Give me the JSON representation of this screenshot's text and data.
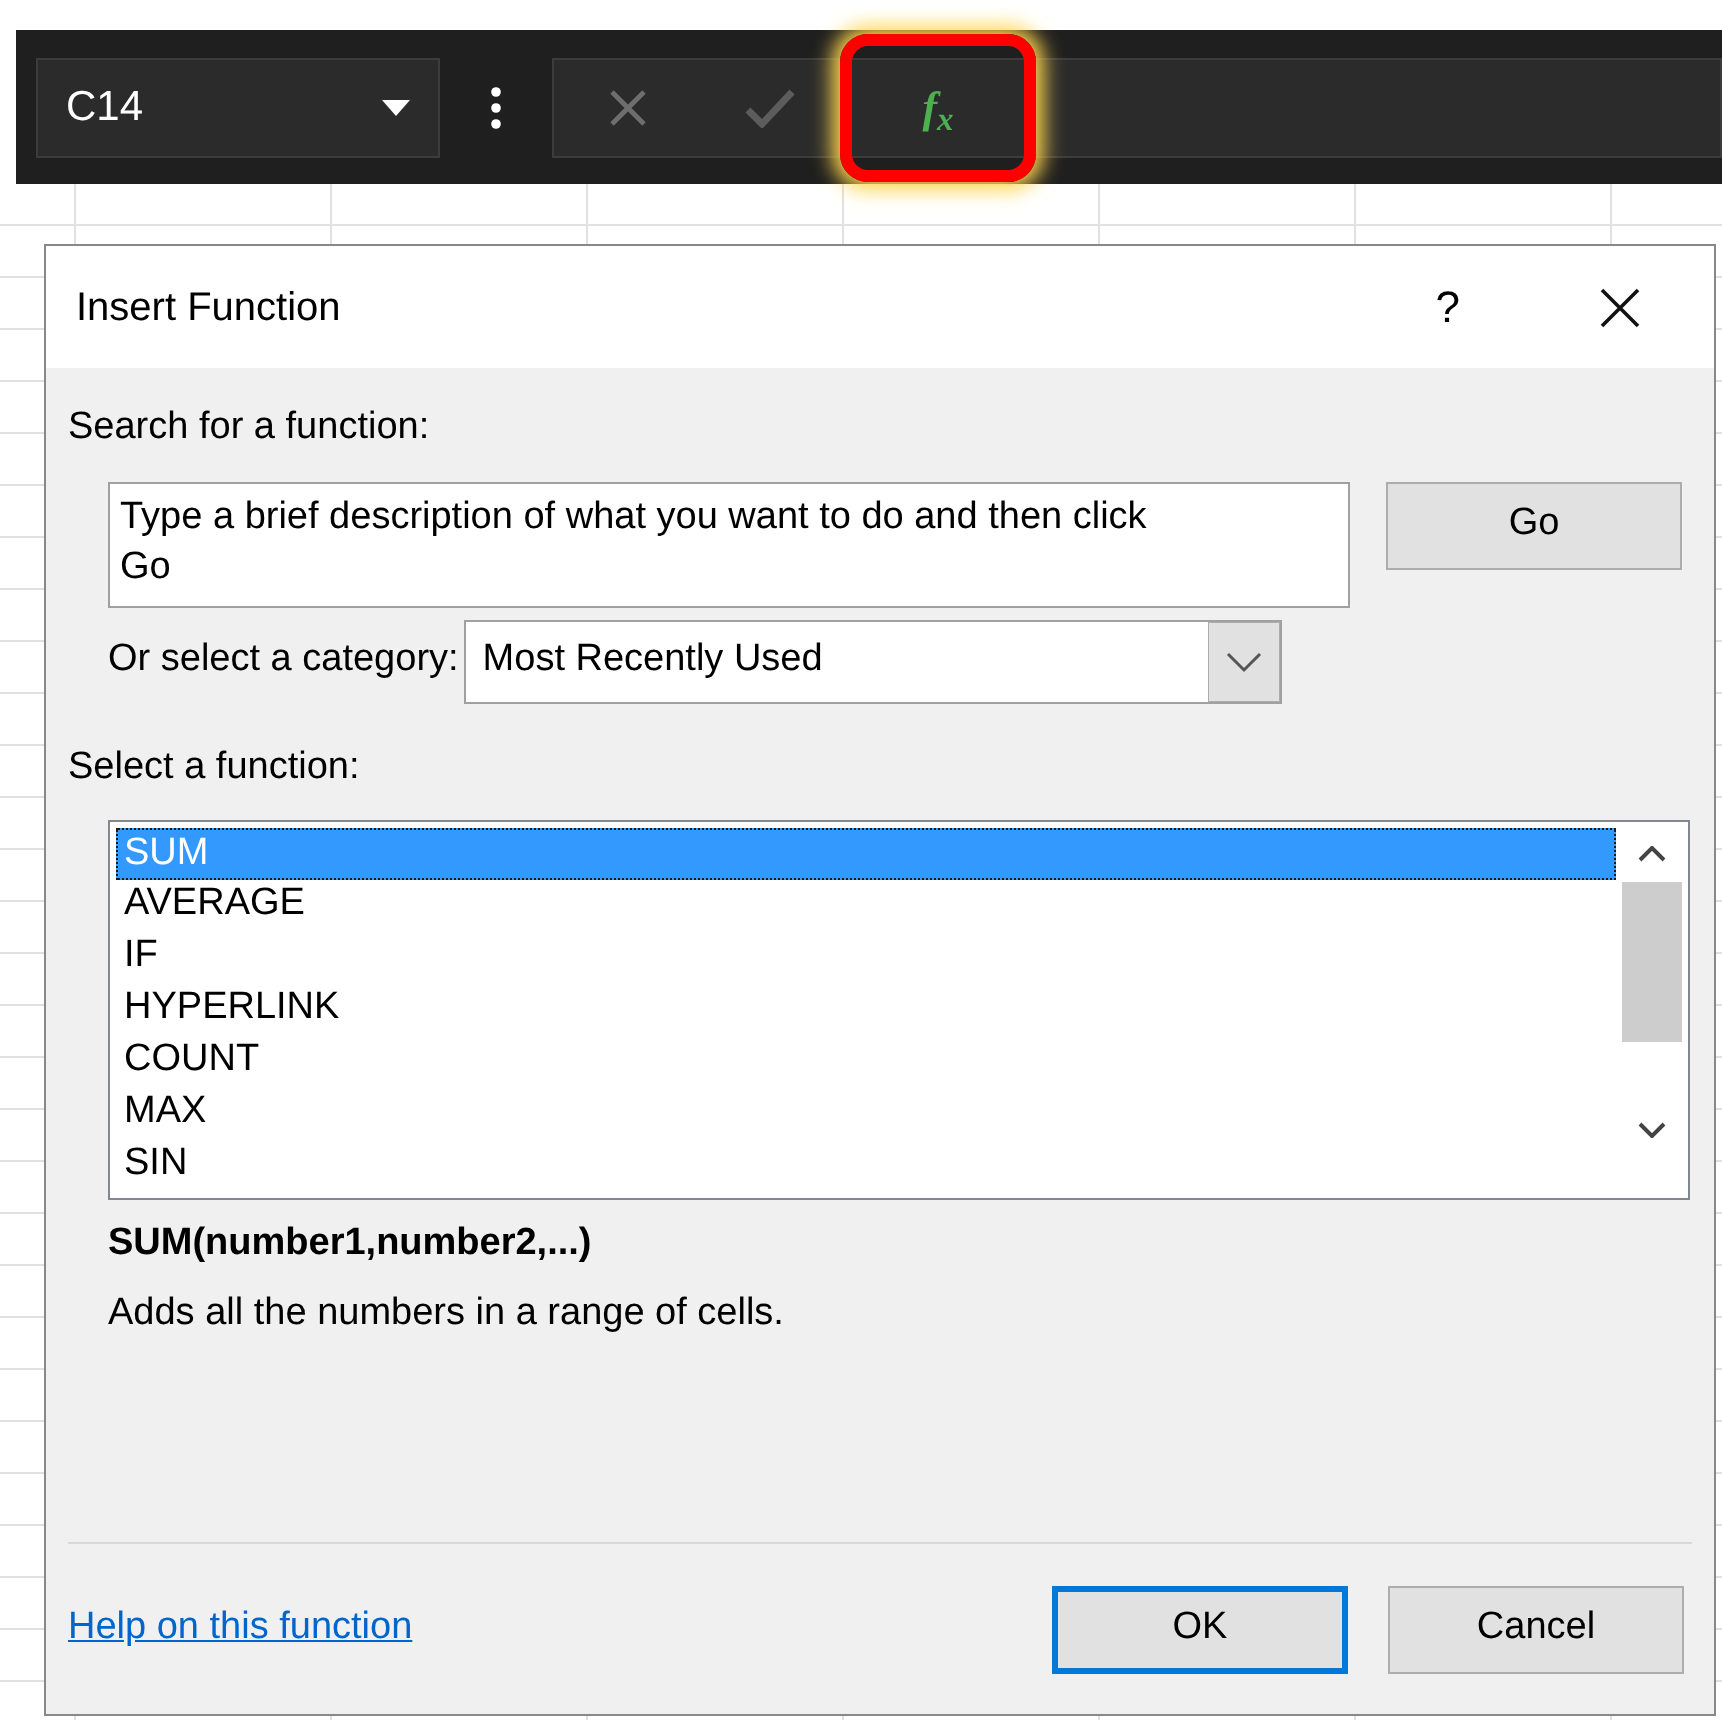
{
  "formula_bar": {
    "name_box": "C14",
    "fx_label": "f$_{x}$",
    "fx_highlighted": true
  },
  "dialog": {
    "title": "Insert Function",
    "help": "?",
    "search_label": "Search for a function:",
    "search_value": "Type a brief description of what you want to do and then click Go",
    "go_button": "Go",
    "category_label": "Or select a category:",
    "category_value": "Most Recently Used",
    "function_label": "Select a function:",
    "functions": [
      {
        "name": "SUM",
        "selected": true
      },
      {
        "name": "AVERAGE",
        "selected": false
      },
      {
        "name": "IF",
        "selected": false
      },
      {
        "name": "HYPERLINK",
        "selected": false
      },
      {
        "name": "COUNT",
        "selected": false
      },
      {
        "name": "MAX",
        "selected": false
      },
      {
        "name": "SIN",
        "selected": false
      }
    ],
    "signature": "SUM(number1,number2,...)",
    "description": "Adds all the numbers in a range of cells.",
    "help_link": "Help on this function",
    "buttons": [
      {
        "label": "OK",
        "default": true
      },
      {
        "label": "Cancel",
        "default": false
      }
    ]
  }
}
